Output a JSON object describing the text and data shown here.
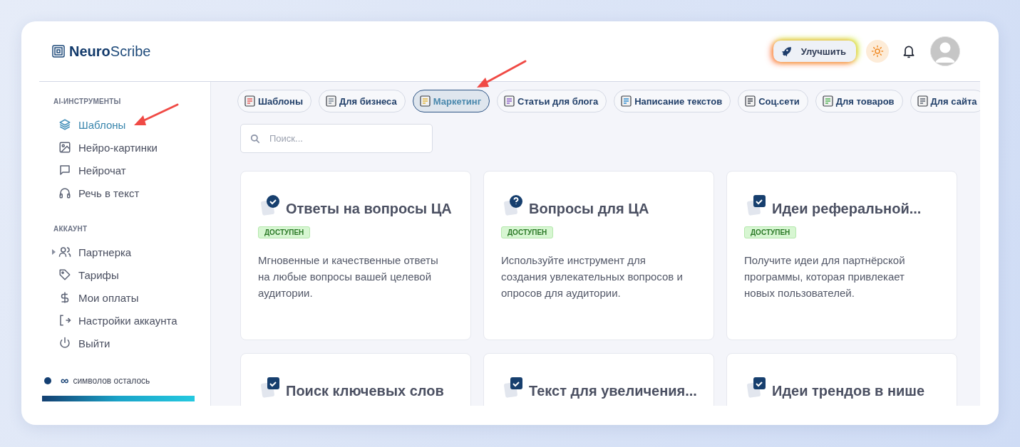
{
  "header": {
    "logo": "**Neuro**Scribe",
    "upgrade_button": "Улучшить"
  },
  "sidebar": {
    "sections": [
      {
        "title": "AI-ИНСТРУМЕНТЫ",
        "items": [
          {
            "label": "Шаблоны",
            "kind": "layers",
            "selected": true,
            "collapsible": false
          },
          {
            "label": "Нейро-картинки",
            "kind": "image",
            "selected": false,
            "collapsible": false
          },
          {
            "label": "Нейрочат",
            "kind": "chat",
            "selected": false,
            "collapsible": false
          },
          {
            "label": "Речь в текст",
            "kind": "headphones",
            "selected": false,
            "collapsible": false
          }
        ]
      },
      {
        "title": "АККАУНТ",
        "items": [
          {
            "label": "Партнерка",
            "kind": "users",
            "selected": false,
            "collapsible": true
          },
          {
            "label": "Тарифы",
            "kind": "tag",
            "selected": false,
            "collapsible": false
          },
          {
            "label": "Мои оплаты",
            "kind": "dollar",
            "selected": false,
            "collapsible": false
          },
          {
            "label": "Настройки аккаунта",
            "kind": "logout",
            "selected": false,
            "collapsible": false
          },
          {
            "label": "Выйти",
            "kind": "power",
            "selected": false,
            "collapsible": false
          }
        ]
      }
    ],
    "usage": {
      "amount": "∞",
      "label": "символов осталось",
      "level": 1
    }
  },
  "categories": [
    {
      "label": "Шаблоны",
      "selected": false
    },
    {
      "label": "Для бизнеса",
      "selected": false
    },
    {
      "label": "Маркетинг",
      "selected": true
    },
    {
      "label": "Статьи для блога",
      "selected": false
    },
    {
      "label": "Написание текстов",
      "selected": false
    },
    {
      "label": "Соц.сети",
      "selected": false
    },
    {
      "label": "Для товаров",
      "selected": false
    },
    {
      "label": "Для сайта",
      "selected": false
    }
  ],
  "search": {
    "placeholder": "Поиск..."
  },
  "cards": [
    {
      "title": "Ответы на вопросы ЦА",
      "kind": "check-circle",
      "badge": "ДОСТУПЕН",
      "description": "Мгновенные и качественные ответы на любые вопросы вашей целевой аудитории."
    },
    {
      "title": "Вопросы для ЦА",
      "kind": "question-circle",
      "badge": "ДОСТУПЕН",
      "description": "Используйте инструмент для создания увлекательных вопросов и опросов для аудитории."
    },
    {
      "title": "Идеи реферальной...",
      "kind": "check-square",
      "badge": "ДОСТУПЕН",
      "description": "Получите идеи для партнёрской программы, которая привлекает новых пользователей."
    },
    {
      "title": "Поиск ключевых слов",
      "kind": "check-square"
    },
    {
      "title": "Текст для увеличения...",
      "kind": "check-square"
    },
    {
      "title": "Идеи трендов в нише",
      "kind": "check-square"
    }
  ]
}
